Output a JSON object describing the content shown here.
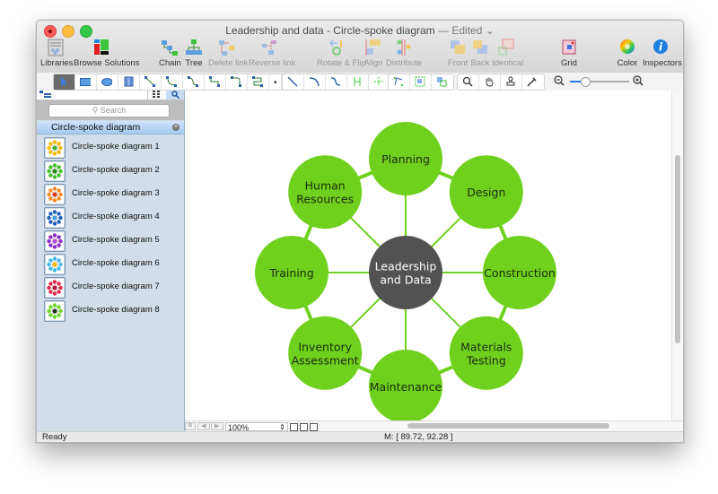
{
  "window": {
    "title": "Leadership and data - Circle-spoke diagram",
    "edited_label": "— Edited ⌄"
  },
  "toolbar": {
    "libraries": "Libraries",
    "browse_solutions": "Browse Solutions",
    "chain": "Chain",
    "tree": "Tree",
    "delete_link": "Delete link",
    "reverse_link": "Reverse link",
    "rotate_flip": "Rotate & Flip",
    "align": "Align",
    "distribute": "Distribute",
    "front": "Front",
    "back": "Back",
    "identical": "Identical",
    "grid": "Grid",
    "color": "Color",
    "inspectors": "Inspectors"
  },
  "tools": {
    "zoom_slider_value": 0.25
  },
  "sidebar": {
    "search_placeholder": "Search",
    "library_name": "Circle-spoke diagram",
    "items": [
      {
        "label": "Circle-spoke diagram 1",
        "outer": "#f5b800",
        "center": "#44b035"
      },
      {
        "label": "Circle-spoke diagram 2",
        "outer": "#3fbf2a",
        "center": "#2a8c1e"
      },
      {
        "label": "Circle-spoke diagram 3",
        "outer": "#f58a1f",
        "center": "#d93a1a"
      },
      {
        "label": "Circle-spoke diagram 4",
        "outer": "#1e5fbf",
        "center": "#3aa0e8"
      },
      {
        "label": "Circle-spoke diagram 5",
        "outer": "#8a2bc2",
        "center": "#b04ad8"
      },
      {
        "label": "Circle-spoke diagram 6",
        "outer": "#3fb7e8",
        "center": "#f5b800"
      },
      {
        "label": "Circle-spoke diagram 7",
        "outer": "#e02848",
        "center": "#b81e38"
      },
      {
        "label": "Circle-spoke diagram 8",
        "outer": "#6ed42a",
        "center": "#1e3a1e"
      }
    ]
  },
  "diagram": {
    "center_lines": [
      "Leadership",
      "and Data"
    ],
    "center_color": "#525252",
    "spoke_color": "#6fd11d",
    "node_color": "#6fd11d",
    "nodes": [
      {
        "lines": [
          "Planning"
        ]
      },
      {
        "lines": [
          "Design"
        ]
      },
      {
        "lines": [
          "Construction"
        ]
      },
      {
        "lines": [
          "Materials",
          "Testing"
        ]
      },
      {
        "lines": [
          "Maintenance"
        ]
      },
      {
        "lines": [
          "Inventory",
          "Assessment"
        ]
      },
      {
        "lines": [
          "Training"
        ]
      },
      {
        "lines": [
          "Human",
          "Resources"
        ]
      }
    ]
  },
  "bottom": {
    "zoom_value": "100%",
    "status": "Ready",
    "coords": "M: [ 89.72, 92.28 ]"
  }
}
